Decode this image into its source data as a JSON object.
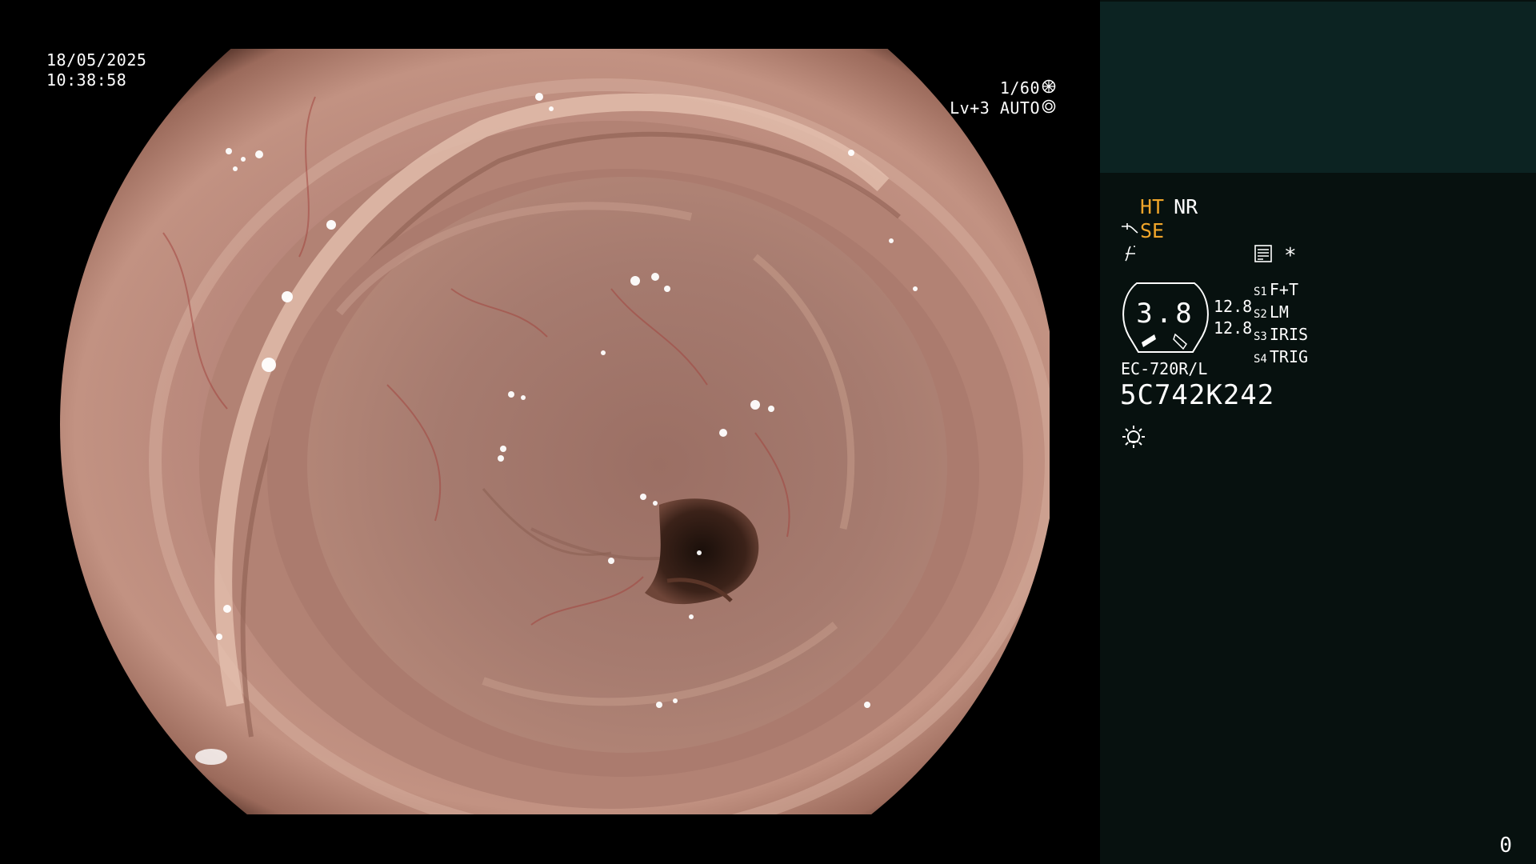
{
  "overlay": {
    "date": "18/05/2025",
    "time": "10:38:58",
    "shutter": "1/60",
    "shutter_icon": "shutter-wheel-icon",
    "light_level": "Lv+3 AUTO",
    "light_icon": "iris-ring-icon"
  },
  "panel": {
    "enhance_mode": "HT",
    "noise_reduction": "NR",
    "structure_mode": "SE",
    "memory_icon": "memory-card-icon",
    "memory_marker": "*",
    "gauge_value": "3.8",
    "scale_top": "12.8",
    "scale_bottom": "12.8",
    "switch_labels": [
      {
        "key": "S1",
        "value": "F+T"
      },
      {
        "key": "S2",
        "value": "LM"
      },
      {
        "key": "S3",
        "value": "IRIS"
      },
      {
        "key": "S4",
        "value": "TRIG"
      }
    ],
    "scope_model": "EC-720R/L",
    "scope_serial": "5C742K242",
    "lamp_icon": "sun-lamp-icon",
    "counter": "0"
  },
  "colors": {
    "background": "#000000",
    "panel": "#07110f",
    "panel_header": "#0c2322",
    "accent_amber": "#f0a52a",
    "text": "#ffffff"
  }
}
